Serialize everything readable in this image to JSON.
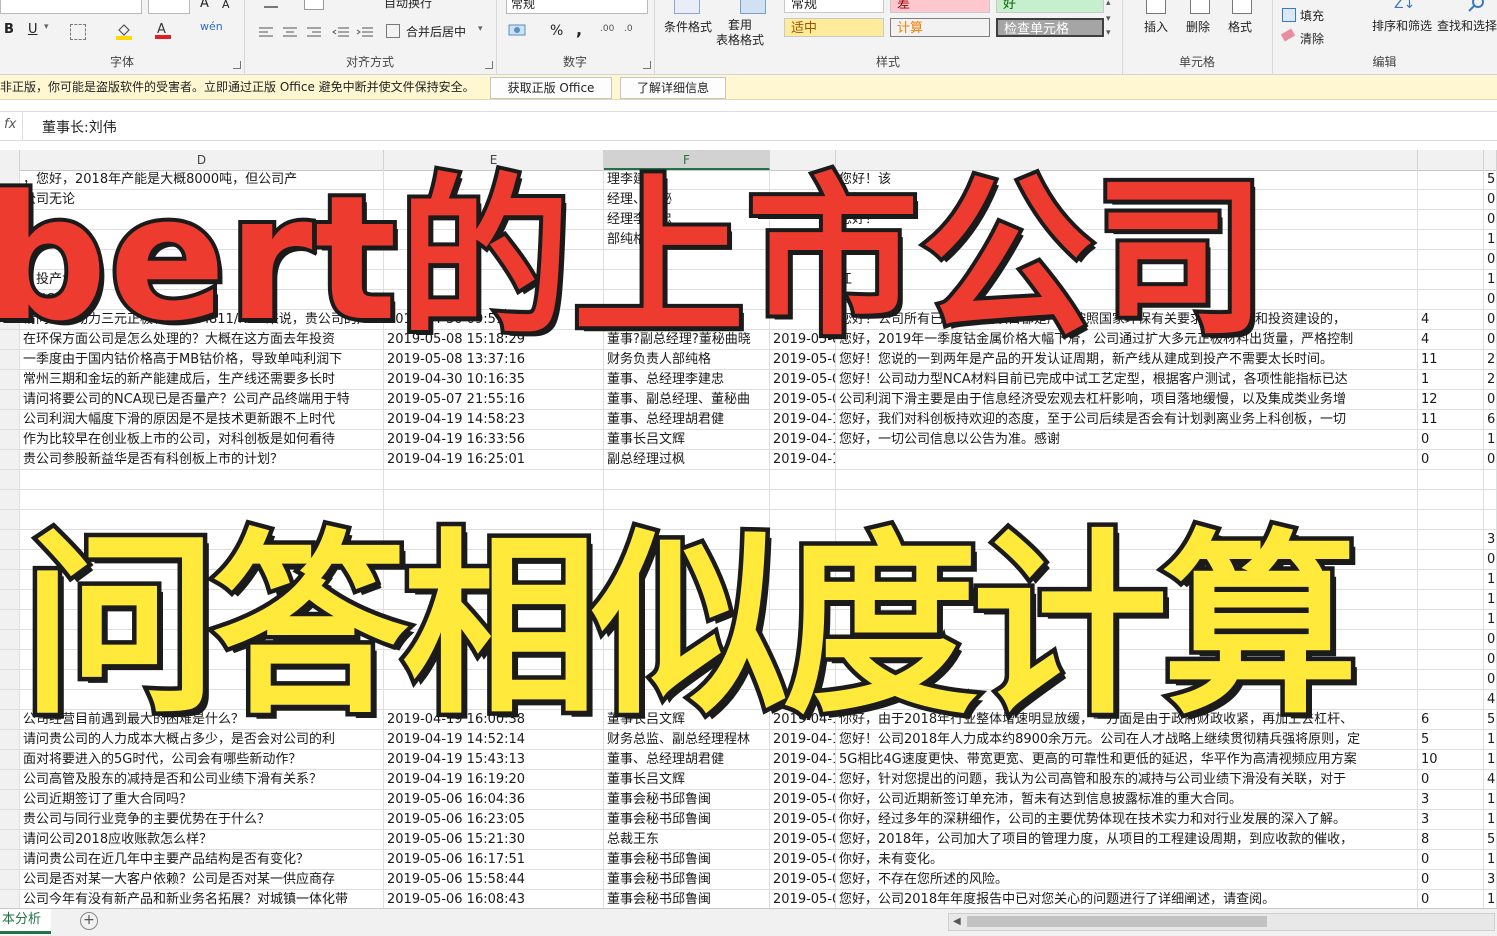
{
  "ribbon": {
    "font_group": "字体",
    "align_group": "对齐方式",
    "number_group": "数字",
    "styles_group": "样式",
    "cells_group": "单元格",
    "edit_group": "编辑",
    "wrap_text": "自动换行",
    "merge_center": "合并后居中",
    "number_format": "常规",
    "percent": "%",
    "comma": ",",
    "cond_format": "条件格式",
    "table_format": "套用\n表格格式",
    "style_normal": "常规",
    "style_bad": "差",
    "style_good": "好",
    "style_neutral": "适中",
    "style_calc": "计算",
    "style_check": "检查单元格",
    "insert": "插入",
    "delete": "删除",
    "format": "格式",
    "fill": "填充",
    "clear": "清除",
    "sort_filter": "排序和筛选",
    "find_select": "查找和选择",
    "bold": "B",
    "underline": "U"
  },
  "message_bar": {
    "text": "非正版，你可能是盗版软件的受害者。立即通过正版 Office 避免中断并使文件保持安全。",
    "btn_get_genuine": "获取正版 Office",
    "btn_learn_more": "了解详细信息"
  },
  "formula_bar": {
    "fx": "fx",
    "content": "董事长:刘伟"
  },
  "columns": [
    "D",
    "E",
    "F"
  ],
  "rows": [
    {
      "q": "，您好，2018年产能是大概8000吨，但公司产",
      "qt": "",
      "a": "理李建忠",
      "at": "",
      "r": "您好！该",
      "n1": "",
      "n2": "5"
    },
    {
      "q": "公司无论",
      "qt": "",
      "a": "经理、董秘",
      "at": "",
      "r": "您好！工",
      "n1": "",
      "n2": "0"
    },
    {
      "q": "",
      "qt": "",
      "a": "经理李建忠",
      "at": "",
      "r": "您好！",
      "n1": "",
      "n2": "0"
    },
    {
      "q": "",
      "qt": "",
      "a": "部纯格",
      "at": "",
      "r": "",
      "n1": "",
      "n2": "1"
    },
    {
      "q": "",
      "qt": "",
      "a": "",
      "at": "",
      "r": "",
      "n1": "",
      "n2": "0"
    },
    {
      "q": "，投产大约",
      "qt": "",
      "a": "",
      "at": "",
      "r": "江",
      "n1": "",
      "n2": "1"
    },
    {
      "q": "的NC",
      "qt": "",
      "a": "",
      "at": "",
      "r": "公",
      "n1": "",
      "n2": "0"
    },
    {
      "q": "请问单就动力三元正极材料NCM811/NCA来说，贵公司的产",
      "qt": "2019-04-30 09:51:57",
      "a": "董事?副总经理",
      "at": "",
      "r": "您好！公司所有已建和在建项目都是严格按照国家环保有关要求进行设计和投资建设的，",
      "n1": "4",
      "n2": "0"
    },
    {
      "q": "在环保方面公司是怎么处理的？大概在这方面去年投资",
      "qt": "2019-05-08 15:18:29",
      "a": "董事?副总经理?董秘曲晓",
      "at": "2019-05-08",
      "r": "您好，2019年一季度钴金属价格大幅下滑，公司通过扩大多元正极材料出货量，严格控制",
      "n1": "4",
      "n2": "0"
    },
    {
      "q": "一季度由于国内钴价格高于MB钴价格，导致单吨利润下",
      "qt": "2019-05-08 13:37:16",
      "a": "财务负责人部纯格",
      "at": "2019-05-08",
      "r": "您好！您说的一到两年是产品的开发认证周期，新产线从建成到投产不需要太长时间。",
      "n1": "11",
      "n2": "2"
    },
    {
      "q": "常州三期和金坛的新产能建成后，生产线还需要多长时",
      "qt": "2019-04-30 10:16:35",
      "a": "董事、总经理李建忠",
      "at": "2019-05-08",
      "r": "您好！公司动力型NCA材料目前已完成中试工艺定型，根据客户测试，各项性能指标已达",
      "n1": "1",
      "n2": "2"
    },
    {
      "q": "请问将要公司的NCA现已是否量产？公司产品终端用于特",
      "qt": "2019-05-07 21:55:16",
      "a": "董事、副总经理、董秘曲",
      "at": "2019-05-08",
      "r": "公司利润下滑主要是由于信息经济受宏观去杠杆影响，项目落地缓慢，以及集成类业务增",
      "n1": "12",
      "n2": "0"
    },
    {
      "q": "公司利润大幅度下滑的原因是不是技术更新跟不上时代",
      "qt": "2019-04-19 14:58:23",
      "a": "董事、总经理胡君健",
      "at": "2019-04-1",
      "r": "您好，我们对科创板持欢迎的态度，至于公司后续是否会有计划剥离业务上科创板，一切",
      "n1": "11",
      "n2": "6"
    },
    {
      "q": "作为比较早在创业板上市的公司，对科创板是如何看待",
      "qt": "2019-04-19 16:33:56",
      "a": "董事长吕文辉",
      "at": "2019-04-1",
      "r": "您好，一切公司信息以公告为准。感谢",
      "n1": "0",
      "n2": "1"
    },
    {
      "q": "贵公司参股新益华是否有科创板上市的计划？",
      "qt": "2019-04-19 16:25:01",
      "a": "副总经理过枫",
      "at": "2019-04-1",
      "r": "",
      "n1": "0",
      "n2": "0"
    },
    {
      "q": "",
      "qt": "",
      "a": "",
      "at": "",
      "r": "",
      "n1": "",
      "n2": ""
    },
    {
      "q": "",
      "qt": "",
      "a": "",
      "at": "",
      "r": "",
      "n1": "",
      "n2": ""
    },
    {
      "q": "",
      "qt": "",
      "a": "",
      "at": "",
      "r": "",
      "n1": "",
      "n2": ""
    },
    {
      "q": "",
      "qt": "",
      "a": "",
      "at": "",
      "r": "",
      "n1": "",
      "n2": "3"
    },
    {
      "q": "",
      "qt": "",
      "a": "",
      "at": "",
      "r": "",
      "n1": "",
      "n2": "0"
    },
    {
      "q": "",
      "qt": "",
      "a": "",
      "at": "",
      "r": "",
      "n1": "",
      "n2": "1"
    },
    {
      "q": "",
      "qt": "",
      "a": "",
      "at": "",
      "r": "",
      "n1": "",
      "n2": "1"
    },
    {
      "q": "",
      "qt": "",
      "a": "",
      "at": "",
      "r": "",
      "n1": "",
      "n2": "1"
    },
    {
      "q": "",
      "qt": "",
      "a": "",
      "at": "",
      "r": "",
      "n1": "",
      "n2": "0"
    },
    {
      "q": "",
      "qt": "",
      "a": "",
      "at": "",
      "r": "",
      "n1": "",
      "n2": "0"
    },
    {
      "q": "",
      "qt": "",
      "a": "",
      "at": "",
      "r": "",
      "n1": "",
      "n2": "0"
    },
    {
      "q": "",
      "qt": "",
      "a": "",
      "at": "",
      "r": "",
      "n1": "",
      "n2": "4"
    },
    {
      "q": "公司经营目前遇到最大的困难是什么？",
      "qt": "2019-04-19 16:00:38",
      "a": "董事长吕文辉",
      "at": "2019-04-1",
      "r": "你好，由于2018年行业整体增速明显放缓，一方面是由于政府财政收紧，再加上去杠杆、",
      "n1": "6",
      "n2": "5"
    },
    {
      "q": "请问贵公司的人力成本大概占多少，是否会对公司的利",
      "qt": "2019-04-19 14:52:14",
      "a": "财务总监、副总经理程林",
      "at": "2019-04-1",
      "r": "您好！公司2018年人力成本约8900余万元。公司在人才战略上继续贯彻精兵强将原则，定",
      "n1": "5",
      "n2": "1"
    },
    {
      "q": "面对将要进入的5G时代，公司会有哪些新动作？",
      "qt": "2019-04-19 15:43:13",
      "a": "董事、总经理胡君健",
      "at": "2019-04-1",
      "r": "5G相比4G速度更快、带宽更宽、更高的可靠性和更低的延迟，华平作为高清视频应用方案",
      "n1": "10",
      "n2": "1"
    },
    {
      "q": "公司高管及股东的减持是否和公司业绩下滑有关系？",
      "qt": "2019-04-19 16:19:20",
      "a": "董事长吕文辉",
      "at": "2019-04-1",
      "r": "您好，针对您提出的问题，我认为公司高管和股东的减持与公司业绩下滑没有关联，对于",
      "n1": "0",
      "n2": "4"
    },
    {
      "q": "公司近期签订了重大合同吗？",
      "qt": "2019-05-06 16:04:36",
      "a": "董事会秘书邱鲁闽",
      "at": "2019-05-0",
      "r": "你好，公司近期新签订单充沛，暂未有达到信息披露标准的重大合同。",
      "n1": "3",
      "n2": "1"
    },
    {
      "q": "贵公司与同行业竞争的主要优势在于什么？",
      "qt": "2019-05-06 16:23:05",
      "a": "董事会秘书邱鲁闽",
      "at": "2019-05-0",
      "r": "你好，经过多年的深耕细作，公司的主要优势体现在技术实力和对行业发展的深入了解。",
      "n1": "3",
      "n2": "1"
    },
    {
      "q": "请问公司2018应收账款怎么样？",
      "qt": "2019-05-06 15:21:30",
      "a": "总裁王东",
      "at": "2019-05-0",
      "r": "您好，2018年，公司加大了项目的管理力度，从项目的工程建设周期，到应收款的催收，",
      "n1": "8",
      "n2": "5"
    },
    {
      "q": "请问贵公司在近几年中主要产品结构是否有变化？",
      "qt": "2019-05-06 16:17:51",
      "a": "董事会秘书邱鲁闽",
      "at": "2019-05-0",
      "r": "你好，未有变化。",
      "n1": "0",
      "n2": "1"
    },
    {
      "q": "公司是否对某一大客户依赖？公司是否对某一供应商存",
      "qt": "2019-05-06 15:58:44",
      "a": "董事会秘书邱鲁闽",
      "at": "2019-05-0",
      "r": "您好，不存在您所述的风险。",
      "n1": "0",
      "n2": "3"
    },
    {
      "q": "公司今年有没有新产品和新业务名拓展？对城镇一体化带",
      "qt": "2019-05-06 16:08:43",
      "a": "董事会秘书邱鲁闽",
      "at": "2019-05-0",
      "r": "您好，公司2018年年度报告中已对您关心的问题进行了详细阐述，请查阅。",
      "n1": "0",
      "n2": "1"
    }
  ],
  "sheet_tab": "本分析",
  "overlay": {
    "top_title": "bert的上市公司",
    "bottom_title": "问答相似度计算"
  },
  "colors": {
    "top_title": "#ee3b30",
    "bottom_title": "#ffe93a",
    "outline": "#1b1b1b",
    "excel_green": "#217346"
  }
}
